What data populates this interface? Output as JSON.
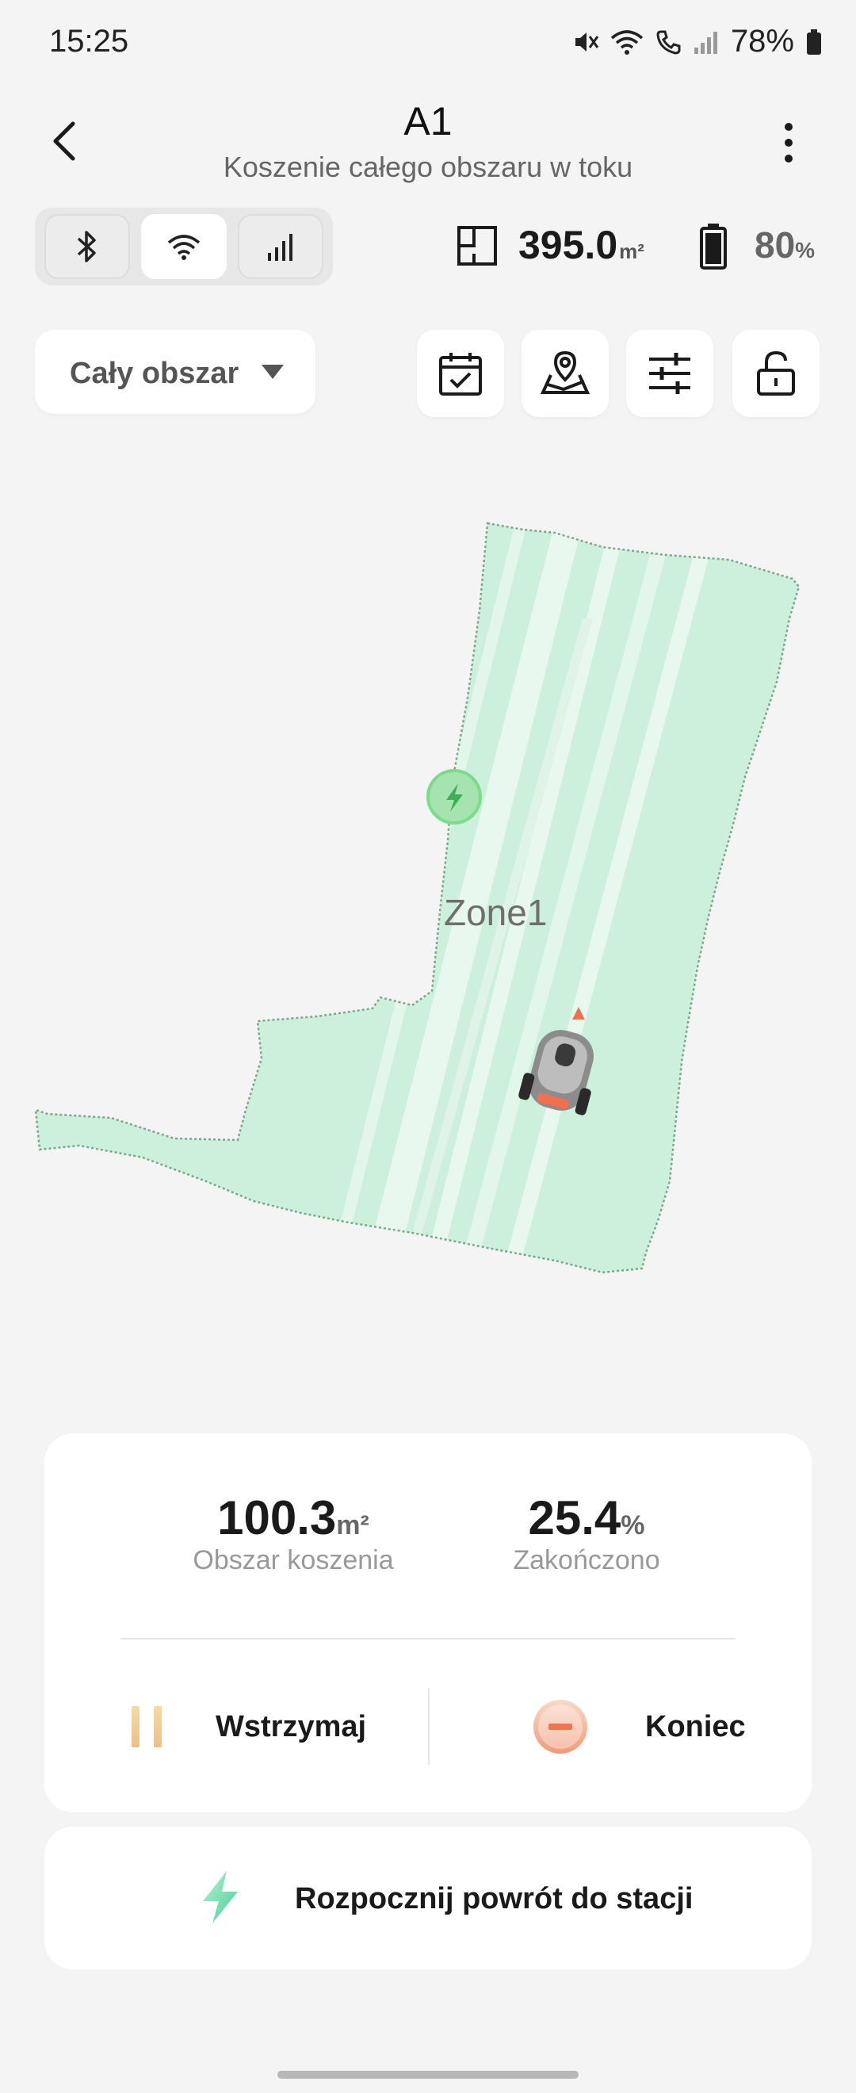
{
  "status_bar": {
    "time": "15:25",
    "battery": "78%",
    "icons": [
      "mute-icon",
      "wifi-icon",
      "call-icon",
      "signal-icon",
      "battery-icon"
    ]
  },
  "header": {
    "title": "A1",
    "subtitle": "Koszenie całego obszaru w toku"
  },
  "connection": {
    "icons": [
      "bluetooth-icon",
      "wifi-icon",
      "cellular-icon"
    ],
    "active": "wifi-icon"
  },
  "summary": {
    "area_value": "395.0",
    "area_unit": "m²",
    "battery_value": "80",
    "battery_unit": "%"
  },
  "zone_selector": {
    "label": "Cały obszar"
  },
  "toolbar": {
    "icons": [
      "schedule-icon",
      "map-pin-icon",
      "settings-sliders-icon",
      "unlock-icon"
    ]
  },
  "map": {
    "zone_name": "Zone1",
    "colors": {
      "zone_fill": "#cdf0dc",
      "mowed_stripe": "#e9f8ef",
      "charger": "#7ddc8c"
    }
  },
  "stats": {
    "mowed_area_value": "100.3",
    "mowed_area_unit": "m²",
    "mowed_area_label": "Obszar koszenia",
    "completed_value": "25.4",
    "completed_unit": "%",
    "completed_label": "Zakończono"
  },
  "actions": {
    "pause_label": "Wstrzymaj",
    "end_label": "Koniec",
    "return_label": "Rozpocznij powrót do stacji"
  }
}
